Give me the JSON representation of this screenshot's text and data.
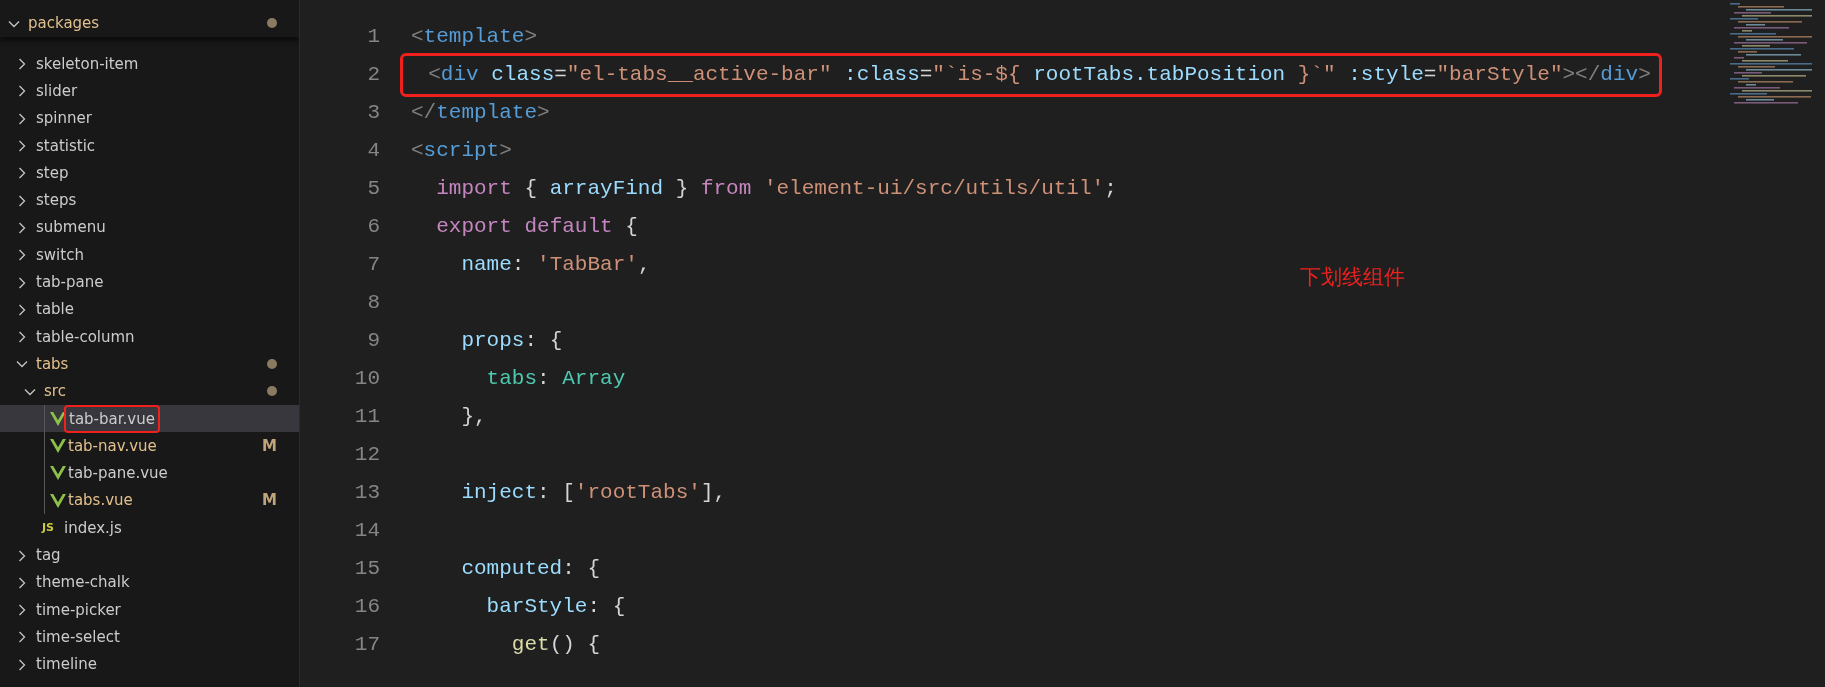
{
  "explorer": {
    "tree": [
      {
        "label": "packages",
        "kind": "folder",
        "expanded": true,
        "modified": true,
        "selected": false,
        "children": [
          {
            "label": "skeleton-item",
            "kind": "folder",
            "expanded": false,
            "modified": false,
            "selected": false
          },
          {
            "label": "slider",
            "kind": "folder",
            "expanded": false,
            "modified": false,
            "selected": false
          },
          {
            "label": "spinner",
            "kind": "folder",
            "expanded": false,
            "modified": false,
            "selected": false
          },
          {
            "label": "statistic",
            "kind": "folder",
            "expanded": false,
            "modified": false,
            "selected": false
          },
          {
            "label": "step",
            "kind": "folder",
            "expanded": false,
            "modified": false,
            "selected": false
          },
          {
            "label": "steps",
            "kind": "folder",
            "expanded": false,
            "modified": false,
            "selected": false
          },
          {
            "label": "submenu",
            "kind": "folder",
            "expanded": false,
            "modified": false,
            "selected": false
          },
          {
            "label": "switch",
            "kind": "folder",
            "expanded": false,
            "modified": false,
            "selected": false
          },
          {
            "label": "tab-pane",
            "kind": "folder",
            "expanded": false,
            "modified": false,
            "selected": false
          },
          {
            "label": "table",
            "kind": "folder",
            "expanded": false,
            "modified": false,
            "selected": false
          },
          {
            "label": "table-column",
            "kind": "folder",
            "expanded": false,
            "modified": false,
            "selected": false
          },
          {
            "label": "tabs",
            "kind": "folder",
            "expanded": true,
            "modified": true,
            "selected": false,
            "children": [
              {
                "label": "src",
                "kind": "folder",
                "expanded": true,
                "modified": true,
                "selected": false,
                "children": [
                  {
                    "label": "tab-bar.vue",
                    "kind": "vue",
                    "selected": true,
                    "highlighted": true
                  },
                  {
                    "label": "tab-nav.vue",
                    "kind": "vue",
                    "git_status": "M",
                    "selected": false
                  },
                  {
                    "label": "tab-pane.vue",
                    "kind": "vue",
                    "selected": false
                  },
                  {
                    "label": "tabs.vue",
                    "kind": "vue",
                    "git_status": "M",
                    "selected": false
                  }
                ]
              },
              {
                "label": "index.js",
                "kind": "js",
                "icon_label": "JS",
                "selected": false
              }
            ]
          },
          {
            "label": "tag",
            "kind": "folder",
            "expanded": false,
            "modified": false,
            "selected": false
          },
          {
            "label": "theme-chalk",
            "kind": "folder",
            "expanded": false,
            "modified": false,
            "selected": false
          },
          {
            "label": "time-picker",
            "kind": "folder",
            "expanded": false,
            "modified": false,
            "selected": false
          },
          {
            "label": "time-select",
            "kind": "folder",
            "expanded": false,
            "modified": false,
            "selected": false
          },
          {
            "label": "timeline",
            "kind": "folder",
            "expanded": false,
            "modified": false,
            "selected": false
          }
        ]
      }
    ]
  },
  "editor": {
    "lines": [
      {
        "number": "1",
        "tokens": [
          {
            "kind": "punct",
            "text": "<"
          },
          {
            "kind": "tag",
            "text": "template"
          },
          {
            "kind": "punct",
            "text": ">"
          }
        ]
      },
      {
        "number": "2",
        "highlighted": true,
        "tokens": [
          {
            "kind": "punct",
            "text": "  <"
          },
          {
            "kind": "tag",
            "text": "div"
          },
          {
            "kind": "attr",
            "text": " class"
          },
          {
            "kind": "plain",
            "text": "="
          },
          {
            "kind": "str",
            "text": "\"el-tabs__active-bar\""
          },
          {
            "kind": "attr",
            "text": " :class"
          },
          {
            "kind": "plain",
            "text": "="
          },
          {
            "kind": "str",
            "text": "\"`is-${ "
          },
          {
            "kind": "var",
            "text": "rootTabs.tabPosition"
          },
          {
            "kind": "str",
            "text": " }`\""
          },
          {
            "kind": "attr",
            "text": " :style"
          },
          {
            "kind": "plain",
            "text": "="
          },
          {
            "kind": "str",
            "text": "\"barStyle\""
          },
          {
            "kind": "punct",
            "text": "></"
          },
          {
            "kind": "tag",
            "text": "div"
          },
          {
            "kind": "punct",
            "text": ">"
          }
        ]
      },
      {
        "number": "3",
        "tokens": [
          {
            "kind": "punct",
            "text": "</"
          },
          {
            "kind": "tag",
            "text": "template"
          },
          {
            "kind": "punct",
            "text": ">"
          }
        ]
      },
      {
        "number": "4",
        "tokens": [
          {
            "kind": "punct",
            "text": "<"
          },
          {
            "kind": "tag",
            "text": "script"
          },
          {
            "kind": "punct",
            "text": ">"
          }
        ]
      },
      {
        "number": "5",
        "tokens": [
          {
            "kind": "kw",
            "text": "  import"
          },
          {
            "kind": "plain",
            "text": " { "
          },
          {
            "kind": "var",
            "text": "arrayFind"
          },
          {
            "kind": "plain",
            "text": " } "
          },
          {
            "kind": "kw",
            "text": "from"
          },
          {
            "kind": "str",
            "text": " 'element-ui/src/utils/util'"
          },
          {
            "kind": "plain",
            "text": ";"
          }
        ]
      },
      {
        "number": "6",
        "tokens": [
          {
            "kind": "kw",
            "text": "  export"
          },
          {
            "kind": "kw",
            "text": " default"
          },
          {
            "kind": "plain",
            "text": " {"
          }
        ]
      },
      {
        "number": "7",
        "tokens": [
          {
            "kind": "var",
            "text": "    name"
          },
          {
            "kind": "plain",
            "text": ": "
          },
          {
            "kind": "str",
            "text": "'TabBar'"
          },
          {
            "kind": "plain",
            "text": ","
          }
        ]
      },
      {
        "number": "8"
      },
      {
        "number": "9",
        "tokens": [
          {
            "kind": "var",
            "text": "    props"
          },
          {
            "kind": "plain",
            "text": ": {"
          }
        ]
      },
      {
        "number": "10",
        "tokens": [
          {
            "kind": "type",
            "text": "      tabs"
          },
          {
            "kind": "plain",
            "text": ": "
          },
          {
            "kind": "type",
            "text": "Array"
          }
        ]
      },
      {
        "number": "11",
        "tokens": [
          {
            "kind": "plain",
            "text": "    },"
          }
        ]
      },
      {
        "number": "12"
      },
      {
        "number": "13",
        "tokens": [
          {
            "kind": "var",
            "text": "    inject"
          },
          {
            "kind": "plain",
            "text": ": ["
          },
          {
            "kind": "str",
            "text": "'rootTabs'"
          },
          {
            "kind": "plain",
            "text": "],"
          }
        ]
      },
      {
        "number": "14"
      },
      {
        "number": "15",
        "tokens": [
          {
            "kind": "var",
            "text": "    computed"
          },
          {
            "kind": "plain",
            "text": ": {"
          }
        ]
      },
      {
        "number": "16",
        "tokens": [
          {
            "kind": "var",
            "text": "      barStyle"
          },
          {
            "kind": "plain",
            "text": ": {"
          }
        ]
      },
      {
        "number": "17",
        "tokens": [
          {
            "kind": "fn",
            "text": "        get"
          },
          {
            "kind": "plain",
            "text": "() {"
          }
        ]
      }
    ]
  },
  "annotation": {
    "text": "下划线组件"
  }
}
